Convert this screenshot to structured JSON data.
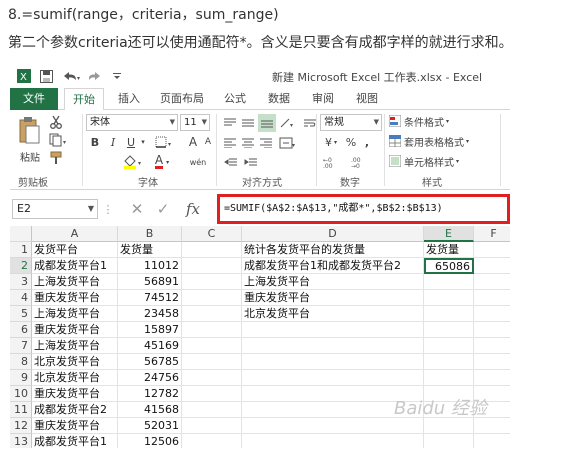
{
  "article": {
    "title": "8.=sumif(range，criteria，sum_range)",
    "description": "第二个参数criteria还可以使用通配符*。含义是只要含有成都字样的就进行求和。"
  },
  "excel": {
    "window_title": "新建 Microsoft Excel 工作表.xlsx - Excel",
    "tabs": [
      "文件",
      "开始",
      "插入",
      "页面布局",
      "公式",
      "数据",
      "审阅",
      "视图"
    ],
    "active_tab": "开始",
    "ribbon": {
      "paste_label": "粘贴",
      "font_name": "宋体",
      "font_size": "11",
      "bold": "B",
      "italic": "I",
      "underline": "U",
      "grow_font": "A",
      "shrink_font": "A",
      "font_color_letter": "A",
      "phonetic": "wén",
      "number_format": "常规",
      "percent": "%",
      "comma": ",",
      "currency": "¥",
      "conditional_format": "条件格式",
      "table_format": "套用表格格式",
      "cell_styles": "单元格样式",
      "groups": [
        "剪贴板",
        "字体",
        "对齐方式",
        "数字",
        "样式"
      ]
    },
    "name_box": "E2",
    "fx_label": "fx",
    "formula": "=SUMIF($A$2:$A$13,\"成都*\",$B$2:$B$13)",
    "columns": [
      "A",
      "B",
      "C",
      "D",
      "E",
      "F"
    ],
    "selected_column": "E",
    "selected_row": "2",
    "rows": [
      {
        "num": "1",
        "A": "发货平台",
        "B": "发货量",
        "D": "统计各发货平台的发货量",
        "E": "发货量"
      },
      {
        "num": "2",
        "A": "成都发货平台1",
        "B": "11012",
        "D": "成都发货平台1和成都发货平台2",
        "E": "65086"
      },
      {
        "num": "3",
        "A": "上海发货平台",
        "B": "56891",
        "D": "上海发货平台",
        "E": ""
      },
      {
        "num": "4",
        "A": "重庆发货平台",
        "B": "74512",
        "D": "重庆发货平台",
        "E": ""
      },
      {
        "num": "5",
        "A": "上海发货平台",
        "B": "23458",
        "D": "北京发货平台",
        "E": ""
      },
      {
        "num": "6",
        "A": "重庆发货平台",
        "B": "15897",
        "D": "",
        "E": ""
      },
      {
        "num": "7",
        "A": "上海发货平台",
        "B": "45169",
        "D": "",
        "E": ""
      },
      {
        "num": "8",
        "A": "北京发货平台",
        "B": "56785",
        "D": "",
        "E": ""
      },
      {
        "num": "9",
        "A": "北京发货平台",
        "B": "24756",
        "D": "",
        "E": ""
      },
      {
        "num": "10",
        "A": "重庆发货平台",
        "B": "12782",
        "D": "",
        "E": ""
      },
      {
        "num": "11",
        "A": "成都发货平台2",
        "B": "41568",
        "D": "",
        "E": ""
      },
      {
        "num": "12",
        "A": "重庆发货平台",
        "B": "52031",
        "D": "",
        "E": ""
      },
      {
        "num": "13",
        "A": "成都发货平台1",
        "B": "12506",
        "D": "",
        "E": ""
      }
    ],
    "watermark": "Baidu 经验"
  },
  "colors": {
    "excel_green": "#217346",
    "highlight_red": "#e02020"
  }
}
